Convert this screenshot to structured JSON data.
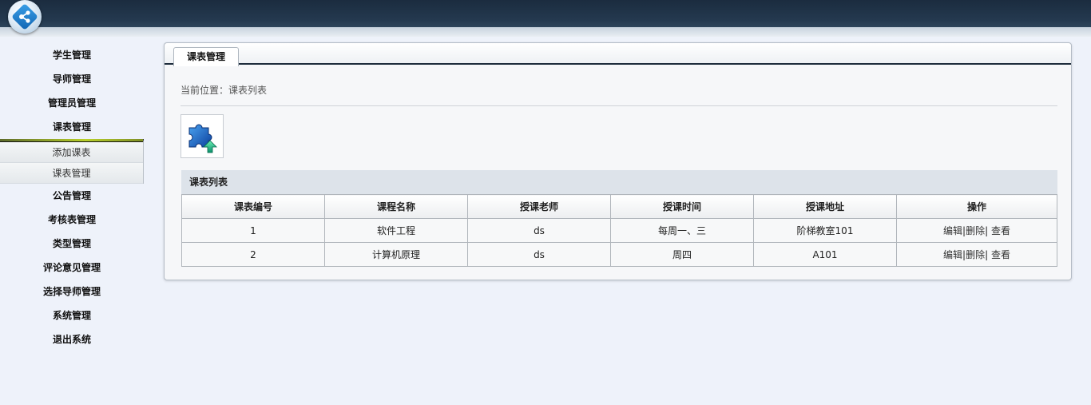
{
  "header": {
    "brand": "",
    "logo_icon": "share-nodes-icon"
  },
  "sidebar": {
    "items": [
      {
        "label": "学生管理"
      },
      {
        "label": "导师管理"
      },
      {
        "label": "管理员管理"
      },
      {
        "label": "课表管理"
      }
    ],
    "submenu": [
      {
        "label": "添加课表"
      },
      {
        "label": "课表管理"
      }
    ],
    "items_after": [
      {
        "label": "公告管理"
      },
      {
        "label": "考核表管理"
      },
      {
        "label": "类型管理"
      },
      {
        "label": "评论意见管理"
      },
      {
        "label": "选择导师管理"
      },
      {
        "label": "系统管理"
      },
      {
        "label": "退出系统"
      }
    ]
  },
  "main": {
    "tab_label": "课表管理",
    "breadcrumb": "当前位置：课表列表",
    "add_icon": "puzzle-add-icon",
    "list_title": "课表列表",
    "table": {
      "headers": [
        "课表编号",
        "课程名称",
        "授课老师",
        "授课时间",
        "授课地址",
        "操作"
      ],
      "rows": [
        {
          "id": "1",
          "course": "软件工程",
          "teacher": "ds",
          "time": "每周一、三",
          "location": "阶梯教室101",
          "edit": "编辑",
          "sep1": "|",
          "delete": "删除",
          "sep2": "|",
          "view": " 查看"
        },
        {
          "id": "2",
          "course": "计算机原理",
          "teacher": "ds",
          "time": "周四",
          "location": "A101",
          "edit": "编辑",
          "sep1": "|",
          "delete": "删除",
          "sep2": "|",
          "view": " 查看"
        }
      ]
    }
  },
  "colors": {
    "header_dark": "#1b2c3f",
    "background": "#eef2fa",
    "accent_bar": "#b8cf2a"
  }
}
